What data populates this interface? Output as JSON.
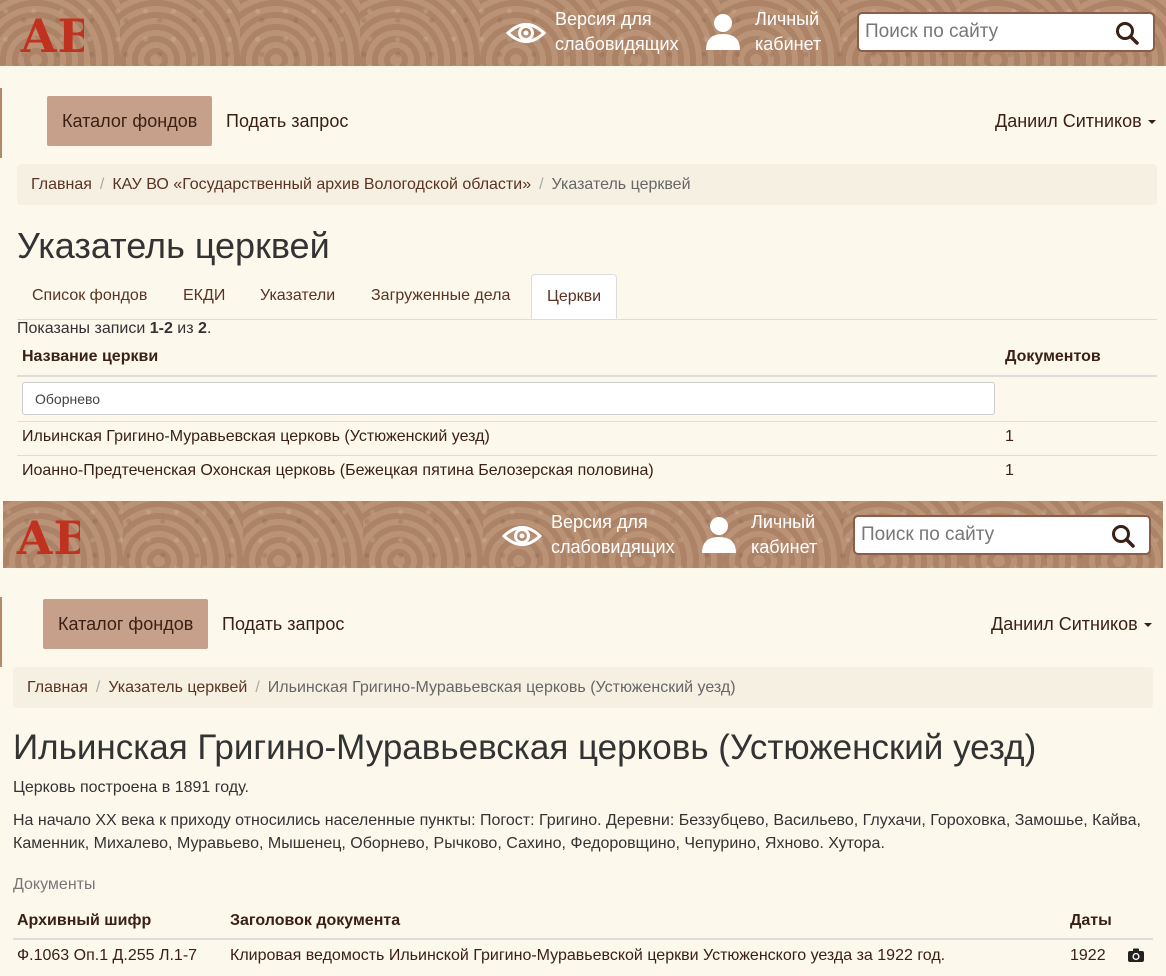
{
  "header": {
    "logo_text": "АВ",
    "low_vision": "Версия для слабовидящих",
    "cabinet": "Личный кабинет",
    "search_placeholder": "Поиск по сайту"
  },
  "nav": {
    "catalog": "Каталог фондов",
    "request": "Подать запрос",
    "user": "Даниил Ситников"
  },
  "page1": {
    "breadcrumb": [
      "Главная",
      "КАУ ВО «Государственный архив Вологодской области»",
      "Указатель церквей"
    ],
    "title": "Указатель церквей",
    "tabs": [
      "Список фондов",
      "ЕКДИ",
      "Указатели",
      "Загруженные дела",
      "Церкви"
    ],
    "summary_prefix": "Показаны записи",
    "summary_range": "1-2",
    "summary_of": "из",
    "summary_total": "2",
    "columns": [
      "Название церкви",
      "Документов"
    ],
    "filter_value": "Оборнево",
    "rows": [
      {
        "name": "Ильинская Григино-Муравьевская церковь (Устюженский уезд)",
        "count": "1"
      },
      {
        "name": "Иоанно-Предтеченская Охонская церковь (Бежецкая пятина Белозерская половина)",
        "count": "1"
      }
    ]
  },
  "page2": {
    "breadcrumb": [
      "Главная",
      "Указатель церквей",
      "Ильинская Григино-Муравьевская церковь (Устюженский уезд)"
    ],
    "title": "Ильинская Григино-Муравьевская церковь (Устюженский уезд)",
    "built": "Церковь построена в 1891 году.",
    "parish": "На начало XX века к приходу относились населенные пункты: Погост: Григино. Деревни: Беззубцево, Васильево, Глухачи, Гороховка, Замошье, Кайва, Каменник, Михалево, Муравьево, Мышенец, Оборнево, Рычково, Сахино, Федоровщино, Чепурино, Яхново. Хутора.",
    "documents_label": "Документы",
    "columns": [
      "Архивный шифр",
      "Заголовок документа",
      "Даты"
    ],
    "docs": [
      {
        "code": "Ф.1063 Оп.1 Д.255 Л.1-7",
        "title": "Клировая ведомость Ильинской Григино-Муравьевской церкви Устюженского уезда за 1922 год.",
        "date": "1922"
      }
    ]
  },
  "colors": {
    "header_bg": "#b58a6c",
    "accent": "#c6a08b",
    "logo_red": "#c0321f",
    "page_bg": "#fcf8ec"
  }
}
